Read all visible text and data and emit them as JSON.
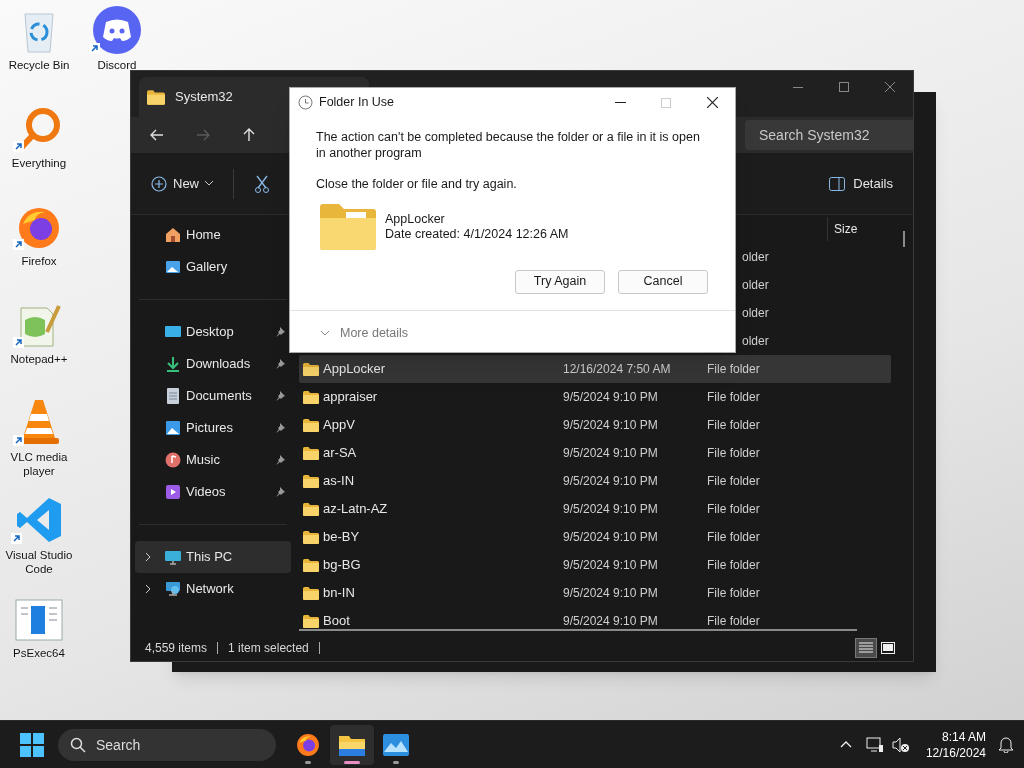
{
  "desktop_icons": [
    {
      "label": "Recycle Bin",
      "kind": "recycle",
      "shortcut": false
    },
    {
      "label": "Discord",
      "kind": "discord",
      "shortcut": true
    },
    {
      "label": "Everything",
      "kind": "everything",
      "shortcut": true
    },
    {
      "label": "Firefox",
      "kind": "firefox",
      "shortcut": true
    },
    {
      "label": "Notepad++",
      "kind": "notepad",
      "shortcut": true
    },
    {
      "label": "VLC media player",
      "kind": "vlc",
      "shortcut": true
    },
    {
      "label": "Visual Studio Code",
      "kind": "vscode",
      "shortcut": true
    },
    {
      "label": "PsExec64",
      "kind": "doc",
      "shortcut": false
    }
  ],
  "explorer": {
    "tab_title": "System32",
    "search": {
      "placeholder": "Search System32"
    },
    "nav": [
      {
        "kind": "back",
        "disabled": false
      },
      {
        "kind": "forward",
        "disabled": true
      },
      {
        "kind": "up",
        "disabled": false
      }
    ],
    "command_bar": {
      "new": "New",
      "details": "Details"
    },
    "sidebar": [
      {
        "label": "Home",
        "kind": "home",
        "pinned": false,
        "selected": false,
        "expandable": false
      },
      {
        "label": "Gallery",
        "kind": "gallery",
        "pinned": false,
        "selected": false,
        "expandable": false
      },
      {
        "label": "Desktop",
        "kind": "desktop",
        "pinned": true,
        "selected": false,
        "expandable": false
      },
      {
        "label": "Downloads",
        "kind": "downloads",
        "pinned": true,
        "selected": false,
        "expandable": false
      },
      {
        "label": "Documents",
        "kind": "documents",
        "pinned": true,
        "selected": false,
        "expandable": false
      },
      {
        "label": "Pictures",
        "kind": "pictures",
        "pinned": true,
        "selected": false,
        "expandable": false
      },
      {
        "label": "Music",
        "kind": "music",
        "pinned": true,
        "selected": false,
        "expandable": false
      },
      {
        "label": "Videos",
        "kind": "videos",
        "pinned": true,
        "selected": false,
        "expandable": false
      },
      {
        "label": "This PC",
        "kind": "pc",
        "pinned": false,
        "selected": true,
        "expandable": true
      },
      {
        "label": "Network",
        "kind": "network",
        "pinned": false,
        "selected": false,
        "expandable": true
      }
    ],
    "columns": [
      {
        "label": "Size"
      }
    ],
    "rows": [
      {
        "type": "older",
        "hidden": true,
        "selected": false
      },
      {
        "type": "older",
        "hidden": true,
        "selected": false
      },
      {
        "type": "older",
        "hidden": true,
        "selected": false
      },
      {
        "type": "older",
        "hidden": true,
        "selected": false
      },
      {
        "name": "AppLocker",
        "date": "12/16/2024 7:50 AM",
        "type": "File folder",
        "hidden": false,
        "selected": true
      },
      {
        "name": "appraiser",
        "date": "9/5/2024 9:10 PM",
        "type": "File folder",
        "hidden": false,
        "selected": false
      },
      {
        "name": "AppV",
        "date": "9/5/2024 9:10 PM",
        "type": "File folder",
        "hidden": false,
        "selected": false
      },
      {
        "name": "ar-SA",
        "date": "9/5/2024 9:10 PM",
        "type": "File folder",
        "hidden": false,
        "selected": false
      },
      {
        "name": "as-IN",
        "date": "9/5/2024 9:10 PM",
        "type": "File folder",
        "hidden": false,
        "selected": false
      },
      {
        "name": "az-Latn-AZ",
        "date": "9/5/2024 9:10 PM",
        "type": "File folder",
        "hidden": false,
        "selected": false
      },
      {
        "name": "be-BY",
        "date": "9/5/2024 9:10 PM",
        "type": "File folder",
        "hidden": false,
        "selected": false
      },
      {
        "name": "bg-BG",
        "date": "9/5/2024 9:10 PM",
        "type": "File folder",
        "hidden": false,
        "selected": false
      },
      {
        "name": "bn-IN",
        "date": "9/5/2024 9:10 PM",
        "type": "File folder",
        "hidden": false,
        "selected": false
      },
      {
        "name": "Boot",
        "date": "9/5/2024 9:10 PM",
        "type": "File folder",
        "hidden": false,
        "selected": false
      }
    ],
    "status": {
      "items": "4,559 items",
      "selection": "1 item selected"
    },
    "views": [
      {
        "kind": "details",
        "selected": true
      },
      {
        "kind": "tiles",
        "selected": false
      }
    ]
  },
  "dialog": {
    "title": "Folder In Use",
    "message": "The action can't be completed because the folder or a file in it is open in another program",
    "hint": "Close the folder or file and try again.",
    "file_name": "AppLocker",
    "file_date": "Date created: 4/1/2024 12:26 AM",
    "maximize_disabled": true,
    "buttons": [
      "Try Again",
      "Cancel"
    ],
    "more_details": "More details"
  },
  "taskbar": {
    "search": {
      "placeholder": "Search"
    },
    "apps": [
      {
        "kind": "firefox",
        "running": true,
        "active": false
      },
      {
        "kind": "explorer",
        "running": true,
        "active": true
      },
      {
        "kind": "photos",
        "running": true,
        "active": false
      }
    ],
    "time": "8:14 AM",
    "date": "12/16/2024"
  }
}
